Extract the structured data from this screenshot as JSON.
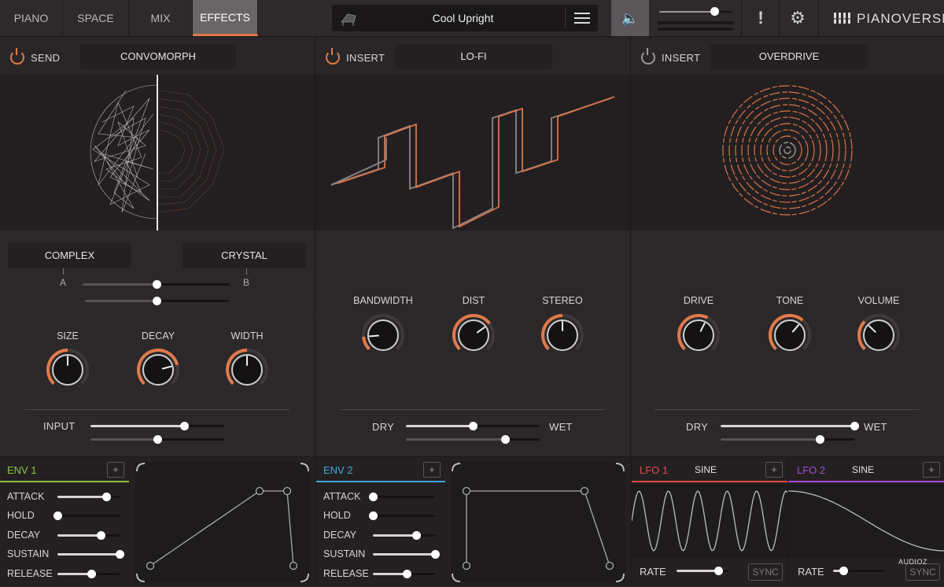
{
  "tabs": [
    {
      "label": "PIANO"
    },
    {
      "label": "SPACE"
    },
    {
      "label": "MIX"
    },
    {
      "label": "EFFECTS"
    }
  ],
  "preset": {
    "name": "Cool Upright"
  },
  "brand": "PIANOVERSE",
  "alert": "!",
  "send": {
    "label": "SEND",
    "effect": "CONVOMORPH",
    "left": "COMPLEX",
    "right": "CRYSTAL",
    "a": "A",
    "b": "B",
    "knobs": [
      {
        "label": "SIZE",
        "value": 0.5
      },
      {
        "label": "DECAY",
        "value": 0.78
      },
      {
        "label": "WIDTH",
        "value": 0.5
      }
    ],
    "input_label": "INPUT",
    "morph": 0.5,
    "input": 0.7
  },
  "lofi": {
    "label": "INSERT",
    "effect": "LO-FI",
    "knobs": [
      {
        "label": "BANDWIDTH",
        "value": 0.15
      },
      {
        "label": "DIST",
        "value": 0.7
      },
      {
        "label": "STEREO",
        "value": 0.5
      }
    ],
    "dry": "DRY",
    "wet": "WET",
    "mix": 0.5
  },
  "overdrive": {
    "label": "INSERT",
    "effect": "OVERDRIVE",
    "knobs": [
      {
        "label": "DRIVE",
        "value": 0.6
      },
      {
        "label": "TONE",
        "value": 0.65
      },
      {
        "label": "VOLUME",
        "value": 0.33
      }
    ],
    "dry": "DRY",
    "wet": "WET",
    "mix": 1.0
  },
  "env1": {
    "title": "ENV 1",
    "plus": "+",
    "params": [
      {
        "label": "ATTACK",
        "value": 0.78
      },
      {
        "label": "HOLD",
        "value": 0.0
      },
      {
        "label": "DECAY",
        "value": 0.69
      },
      {
        "label": "SUSTAIN",
        "value": 1.0
      },
      {
        "label": "RELEASE",
        "value": 0.55
      }
    ]
  },
  "env2": {
    "title": "ENV 2",
    "plus": "+",
    "params": [
      {
        "label": "ATTACK",
        "value": 0.0
      },
      {
        "label": "HOLD",
        "value": 0.0
      },
      {
        "label": "DECAY",
        "value": 0.7
      },
      {
        "label": "SUSTAIN",
        "value": 1.0
      },
      {
        "label": "RELEASE",
        "value": 0.55
      }
    ]
  },
  "lfo1": {
    "title": "LFO 1",
    "wave": "SINE",
    "plus": "+",
    "rate_label": "RATE",
    "sync": "SYNC",
    "rate": 0.8
  },
  "lfo2": {
    "title": "LFO 2",
    "wave": "SINE",
    "plus": "+",
    "rate_label": "RATE",
    "sync": "SYNC",
    "rate": 0.2
  },
  "watermark": "AUDIOZ",
  "colors": {
    "accent": "#e07a4a",
    "env1": "#8cc63f",
    "env2": "#3fa9e0",
    "lfo1": "#e04a4a",
    "lfo2": "#a64ae0"
  }
}
